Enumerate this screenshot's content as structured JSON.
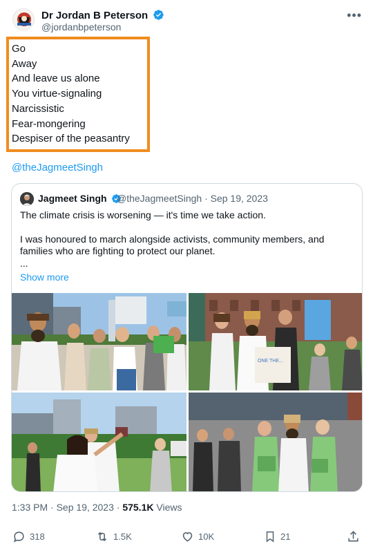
{
  "author": {
    "name": "Dr Jordan B Peterson",
    "handle": "@jordanbpeterson"
  },
  "tweet": {
    "lines": [
      "Go",
      "Away",
      "And leave us alone",
      "You virtue-signaling",
      "Narcissistic",
      "Fear-mongering",
      "Despiser of the peasantry"
    ],
    "mention": "@theJagmeetSingh"
  },
  "quoted": {
    "name": "Jagmeet Singh",
    "handle_date": "@theJagmeetSingh · Sep 19, 2023",
    "paragraph1": "The climate crisis is worsening — it's time we take action.",
    "paragraph2": "I was honoured to march alongside activists, community members, and families who are fighting to protect our planet.",
    "ellipsis": "...",
    "show_more": "Show more",
    "sign_text": "ONE THE..."
  },
  "meta": {
    "time_date": "1:33 PM · Sep 19, 2023 · ",
    "views_count": "575.1K",
    "views_label": " Views"
  },
  "actions": {
    "replies": "318",
    "reposts": "1.5K",
    "likes": "10K",
    "bookmarks": "21"
  },
  "colors": {
    "highlight_border": "#f08c1e",
    "link": "#1d9bf0",
    "verified": "#1d9bf0",
    "secondary_text": "#536471"
  }
}
